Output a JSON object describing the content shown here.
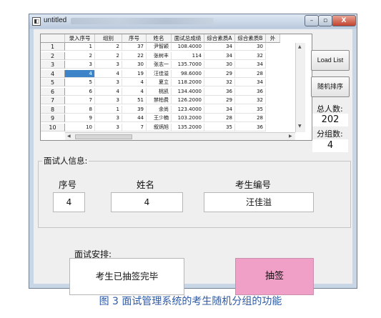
{
  "window": {
    "title": "untitled",
    "close_glyph": "X",
    "app_icon": "app-icon"
  },
  "table": {
    "columns": [
      "录入序号",
      "组别",
      "序号",
      "姓名",
      "面试总成绩",
      "综合素质A",
      "综合素质B",
      "外"
    ],
    "row_headers": [
      "1",
      "2",
      "3",
      "4",
      "5",
      "6",
      "7",
      "8",
      "9",
      "10"
    ],
    "rows": [
      [
        "1",
        "2",
        "37",
        "尹智颖",
        "108.4000",
        "34",
        "30"
      ],
      [
        "2",
        "2",
        "22",
        "张树丰",
        "114",
        "34",
        "32"
      ],
      [
        "3",
        "3",
        "30",
        "张志一",
        "135.7000",
        "30",
        "34"
      ],
      [
        "4",
        "4",
        "19",
        "汪佳溢",
        "98.6000",
        "29",
        "28"
      ],
      [
        "5",
        "3",
        "4",
        "夏立",
        "118.2000",
        "32",
        "34"
      ],
      [
        "6",
        "4",
        "4",
        "桃凯",
        "134.4000",
        "36",
        "36"
      ],
      [
        "7",
        "3",
        "51",
        "禁柏费",
        "126.2000",
        "29",
        "32"
      ],
      [
        "8",
        "1",
        "39",
        "余尚",
        "123.4000",
        "34",
        "35"
      ],
      [
        "9",
        "3",
        "44",
        "王少楠",
        "103.2000",
        "28",
        "28"
      ],
      [
        "10",
        "3",
        "7",
        "叙炳旭",
        "135.2000",
        "35",
        "36"
      ]
    ],
    "selected_row": 3,
    "selected_col": 0
  },
  "side": {
    "load_button": "Load List",
    "sort_button": "随机排序",
    "total_label": "总人数:",
    "total_value": "202",
    "group_label": "分组数:",
    "group_value": "4"
  },
  "info": {
    "title": "面试人信息:",
    "seq_label": "序号",
    "name_label": "姓名",
    "id_label": "考生编号",
    "seq_value": "4",
    "name_value": "4",
    "id_value": "汪佳溢"
  },
  "arrange": {
    "label": "面试安排:",
    "status": "考生已抽签完毕",
    "draw_button": "抽签"
  },
  "caption": "图 3 面试管理系统的考生随机分组的功能",
  "colors": {
    "accent_selected": "#3c84c7",
    "draw_button": "#f0a0c6",
    "caption": "#2c5aa7"
  }
}
